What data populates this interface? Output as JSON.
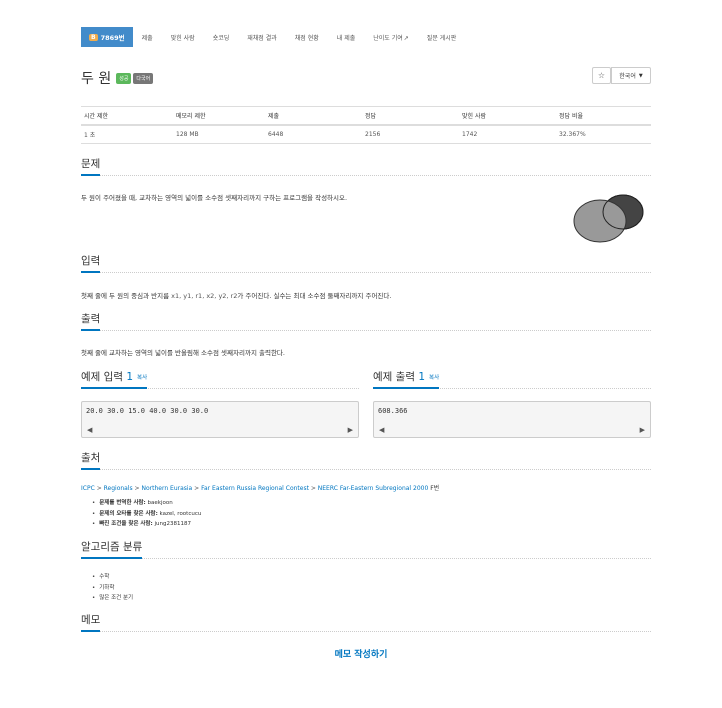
{
  "nav": {
    "active_badge": "B",
    "active_label": "7869번",
    "items": [
      "제출",
      "맞힌 사람",
      "숏코딩",
      "재채점 결과",
      "채점 현황",
      "내 제출",
      "난이도 기여",
      "질문 게시판"
    ]
  },
  "problem": {
    "title": "두 원",
    "label_success": "성공",
    "label_multi": "다국어",
    "star": "☆",
    "language": "한국어"
  },
  "info_table": {
    "headers": [
      "시간 제한",
      "메모리 제한",
      "제출",
      "정답",
      "맞힌 사람",
      "정답 비율"
    ],
    "values": [
      "1 초",
      "128 MB",
      "6448",
      "2156",
      "1742",
      "32.367%"
    ]
  },
  "sections": {
    "problem": "문제",
    "input": "입력",
    "output": "출력",
    "sample_in": "예제 입력",
    "sample_out": "예제 출력",
    "sample_num": "1",
    "copy": "복사",
    "source": "출처",
    "algo": "알고리즘 분류",
    "memo": "메모"
  },
  "problem_text": "두 원이 주어졌을 때, 교차하는 영역의 넓이를 소수점 셋째자리까지 구하는 프로그램을 작성하시오.",
  "input_text": {
    "prefix": "첫째 줄에 두 원의 중심과 반지름",
    "vars": "x1, y1, r1, x2, y2, r2",
    "suffix": "가 주어진다. 실수는 최대 소수점 둘째자리까지 주어진다."
  },
  "output_text": "첫째 줄에 교차하는 영역의 넓이를 반올림해 소수점 셋째자리까지 출력한다.",
  "sample_input": "20.0 30.0 15.0 40.0 30.0 30.0",
  "sample_output": "608.366",
  "source": {
    "links": [
      "ICPC",
      "Regionals",
      "Northern Eurasia",
      "Far Eastern Russia Regional Contest",
      "NEERC Far-Eastern Subregional 2000"
    ],
    "suffix": "F번",
    "credits": [
      {
        "label": "문제를 번역한 사람:",
        "value": "baekjoon"
      },
      {
        "label": "문제의 오타를 찾은 사람:",
        "value": "kazel, rootcucu"
      },
      {
        "label": "빠진 조건을 찾은 사람:",
        "value": "jung2381187"
      }
    ]
  },
  "algorithms": [
    "수학",
    "기하학",
    "많은 조건 분기"
  ],
  "memo_link": "메모 작성하기",
  "colors": {
    "accent": "#0076c0",
    "nav_active": "#428bca",
    "success": "#5cb85c"
  }
}
